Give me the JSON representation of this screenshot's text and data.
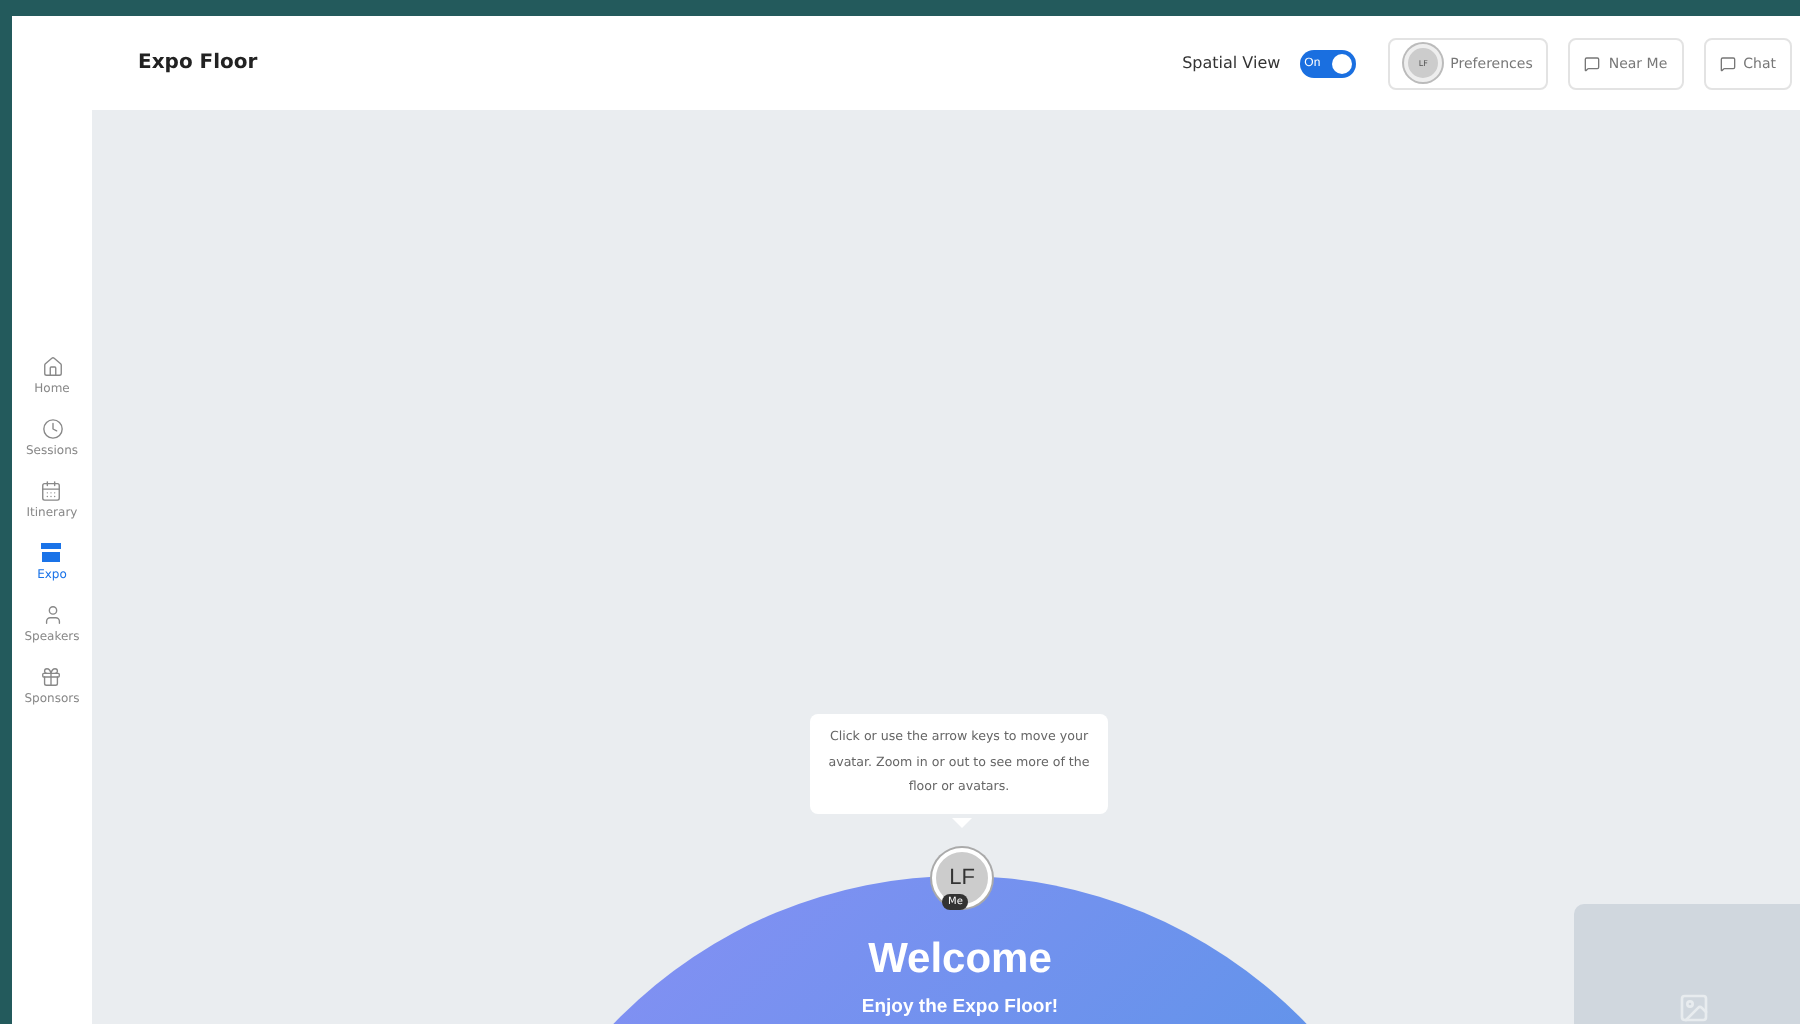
{
  "header": {
    "title": "Expo Floor",
    "spatial_view": {
      "label": "Spatial View",
      "toggle_text": "On",
      "on": true
    },
    "preferences": {
      "avatar_initials": "LF",
      "label": "Preferences"
    },
    "buttons": [
      {
        "label": "Near Me"
      },
      {
        "label": "Chat"
      }
    ]
  },
  "sidebar": {
    "items": [
      {
        "label": "Home",
        "selected": false
      },
      {
        "label": "Sessions",
        "selected": false
      },
      {
        "label": "Itinerary",
        "selected": false
      },
      {
        "label": "Expo",
        "selected": true
      },
      {
        "label": "Speakers",
        "selected": false
      },
      {
        "label": "Sponsors",
        "selected": false
      }
    ]
  },
  "floor": {
    "tooltip": "Click or use the arrow keys to move your avatar. Zoom in or out to see more of the floor or avatars.",
    "avatar": {
      "initials": "LF",
      "tag": "Me"
    },
    "welcome": {
      "title": "Welcome",
      "subtitle": "Enjoy the Expo Floor!"
    }
  }
}
